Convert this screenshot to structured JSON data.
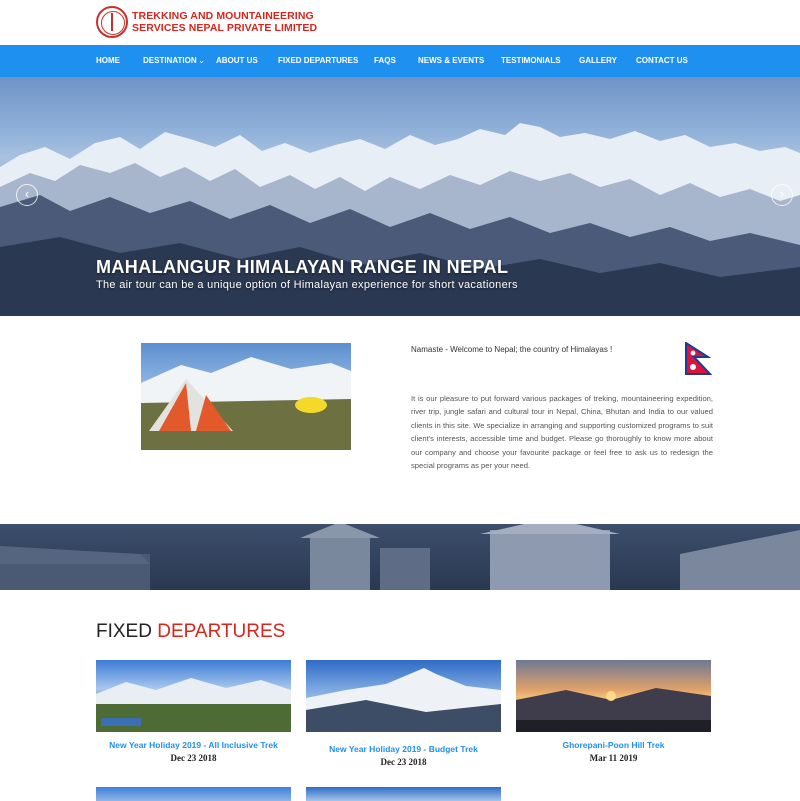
{
  "brand": {
    "line1": "TREKKING AND MOUNTAINEERING",
    "line2": "SERVICES NEPAL PRIVATE LIMITED"
  },
  "nav": {
    "items": [
      {
        "label": "HOME"
      },
      {
        "label": "DESTINATION"
      },
      {
        "label": "ABOUT US"
      },
      {
        "label": "FIXED DEPARTURES"
      },
      {
        "label": "FAQS"
      },
      {
        "label": "NEWS & EVENTS"
      },
      {
        "label": "TESTIMONIALS"
      },
      {
        "label": "GALLERY"
      },
      {
        "label": "CONTACT US"
      }
    ]
  },
  "hero": {
    "title": "MAHALANGUR HIMALAYAN RANGE IN NEPAL",
    "subtitle": "The air tour can be a unique option of Himalayan experience for short vacationers"
  },
  "about": {
    "welcome": "Namaste - Welcome to Nepal; the country of Himalayas !",
    "body": "It is our pleasure to put forward various packages of treking, mountaineering expedition, river trip, jungle safari and cultural tour in Nepal, China, Bhutan and India to our valued clients in this site. We specialize in arranging and supporting customized programs to suit client's interests, accessible time and budget. Please go thoroughly to know more about our company and choose your favourite package or feel free to ask us to redesign the special programs as per your need."
  },
  "fixed_departures": {
    "title_part1": "FIXED ",
    "title_part2": "DEPARTURES",
    "cards": [
      {
        "title": "New Year Holiday 2019 - All Inclusive Trek",
        "date": "Dec 23 2018"
      },
      {
        "title": "New Year Holiday 2019 - Budget Trek",
        "date": "Dec 23 2018"
      },
      {
        "title": "Ghorepani-Poon Hill Trek",
        "date": "Mar 11 2019"
      }
    ]
  },
  "colors": {
    "nav_bg": "#1e90f0",
    "brand_red": "#d9251c",
    "link_blue": "#1e90f0"
  },
  "icons": {
    "prev": "chevron-left-icon",
    "next": "chevron-right-icon",
    "dropdown": "chevron-down-icon"
  }
}
